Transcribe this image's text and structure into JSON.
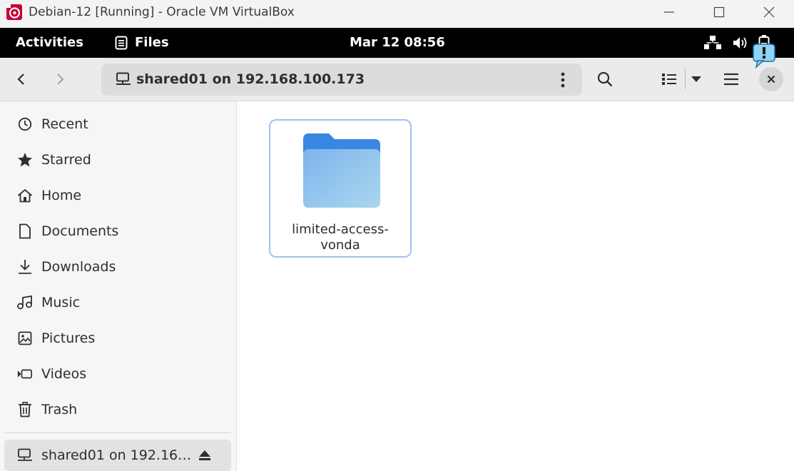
{
  "host_window": {
    "title": "Debian-12 [Running] - Oracle VM VirtualBox"
  },
  "gnome_topbar": {
    "activities_label": "Activities",
    "app_menu_label": "Files",
    "clock": "Mar 12  08:56",
    "tray_icons": [
      "network-unknown-icon",
      "volume-icon",
      "battery-icon"
    ]
  },
  "headerbar": {
    "location_label": "shared01 on 192.168.100.173",
    "location_icon": "network-drive-icon"
  },
  "sidebar": {
    "items": [
      {
        "label": "Recent",
        "icon": "clock-icon"
      },
      {
        "label": "Starred",
        "icon": "star-icon"
      },
      {
        "label": "Home",
        "icon": "home-icon"
      },
      {
        "label": "Documents",
        "icon": "document-icon"
      },
      {
        "label": "Downloads",
        "icon": "download-icon"
      },
      {
        "label": "Music",
        "icon": "music-icon"
      },
      {
        "label": "Pictures",
        "icon": "picture-icon"
      },
      {
        "label": "Videos",
        "icon": "video-icon"
      },
      {
        "label": "Trash",
        "icon": "trash-icon"
      }
    ],
    "mount": {
      "label": "shared01 on 192.16…",
      "icon": "network-drive-icon"
    }
  },
  "content": {
    "items": [
      {
        "name": "limited-access-vonda",
        "name_line1": "limited-access-",
        "name_line2": "vonda",
        "type": "folder",
        "selected": true
      }
    ]
  },
  "colors": {
    "gnome_bar": "#000000",
    "folder_top": "#3a86e3",
    "folder_body": "#8ec0ef",
    "selection_border": "#9ec3ec",
    "accent": "#1c71d8"
  }
}
